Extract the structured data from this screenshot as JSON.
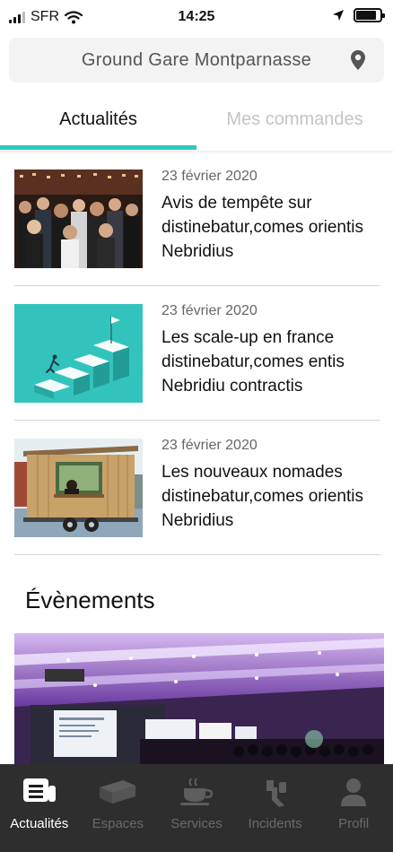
{
  "status_bar": {
    "carrier": "SFR",
    "time": "14:25",
    "battery_level": 0.85
  },
  "location": {
    "name": "Ground Gare Montparnasse",
    "icon": "map-pin-icon"
  },
  "tabs": [
    {
      "label": "Actualités",
      "active": true
    },
    {
      "label": "Mes commandes",
      "active": false
    }
  ],
  "colors": {
    "accent": "#2cc7c2",
    "tab_inactive": "#c4c4c4",
    "nav_bg": "#1e1e1e"
  },
  "news": [
    {
      "date": "23 février 2020",
      "title": "Avis de tempête sur distinebatur,comes orientis Nebridius",
      "image": "crowd-event-photo"
    },
    {
      "date": "23 février 2020",
      "title": "Les scale-up en france distinebatur,comes entis Nebridiu contractis",
      "image": "stairs-illustration"
    },
    {
      "date": "23 février 2020",
      "title": "Les nouveaux nomades distinebatur,comes orientis Nebridius",
      "image": "tiny-house-trailer-photo"
    }
  ],
  "events": {
    "heading": "Évènements",
    "image": "conference-hall-photo"
  },
  "bottom_nav": [
    {
      "label": "Actualités",
      "icon": "newspaper-icon",
      "active": true
    },
    {
      "label": "Espaces",
      "icon": "building-icon",
      "active": false
    },
    {
      "label": "Services",
      "icon": "coffee-cup-icon",
      "active": false
    },
    {
      "label": "Incidents",
      "icon": "wrench-icon",
      "active": false
    },
    {
      "label": "Profil",
      "icon": "person-icon",
      "active": false
    }
  ]
}
